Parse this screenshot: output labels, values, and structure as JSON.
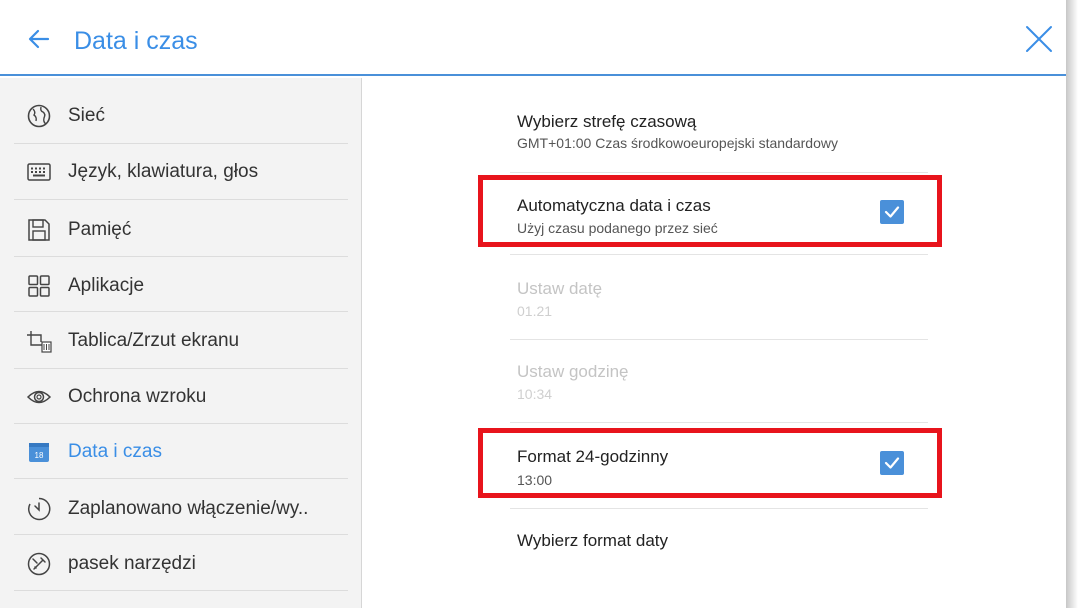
{
  "header": {
    "title": "Data i czas",
    "back_icon": "arrow-left-icon",
    "close_icon": "close-icon",
    "accent_color": "#3a8ee6"
  },
  "sidebar": {
    "items": [
      {
        "label": "Sieć",
        "icon": "globe-icon",
        "active": false
      },
      {
        "label": "Język, klawiatura, głos",
        "icon": "keyboard-icon",
        "active": false
      },
      {
        "label": "Pamięć",
        "icon": "storage-icon",
        "active": false
      },
      {
        "label": "Aplikacje",
        "icon": "apps-grid-icon",
        "active": false
      },
      {
        "label": "Tablica/Zrzut ekranu",
        "icon": "screenshot-icon",
        "active": false
      },
      {
        "label": "Ochrona wzroku",
        "icon": "eye-icon",
        "active": false
      },
      {
        "label": "Data i czas",
        "icon": "calendar-icon",
        "icon_text": "18",
        "active": true
      },
      {
        "label": "Zaplanowano włączenie/wy..",
        "icon": "timer-icon",
        "active": false
      },
      {
        "label": "pasek narzędzi",
        "icon": "toolbar-icon",
        "active": false
      }
    ]
  },
  "settings": [
    {
      "title": "Wybierz strefę czasową",
      "subtitle": "GMT+01:00 Czas środkowoeuropejski standardowy",
      "enabled": true
    },
    {
      "title": "Automatyczna data i czas",
      "subtitle": "Użyj czasu podanego przez sieć",
      "enabled": true,
      "checked": true,
      "highlighted": true
    },
    {
      "title": "Ustaw datę",
      "subtitle": "01.21",
      "enabled": false
    },
    {
      "title": "Ustaw godzinę",
      "subtitle": "10:34",
      "enabled": false
    },
    {
      "title": "Format 24-godzinny",
      "subtitle": "13:00",
      "enabled": true,
      "checked": true,
      "highlighted": true
    },
    {
      "title": "Wybierz format daty",
      "enabled": true
    }
  ],
  "colors": {
    "highlight": "#e8141c",
    "checkbox": "#4a90d9"
  }
}
